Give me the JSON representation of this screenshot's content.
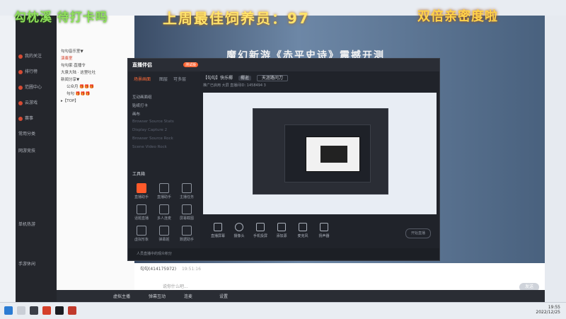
{
  "overlay": {
    "left_caption": "勾枕溪 待打卡吗",
    "center_caption": "上周最佳饲养员：97",
    "right_caption": "双倍亲密度啦"
  },
  "stream": {
    "title": "魔幻新游《赤平史诗》震撼开测"
  },
  "sidebar": {
    "items": [
      {
        "label": "我的关注"
      },
      {
        "label": "排行榜"
      },
      {
        "label": "范圃中心"
      },
      {
        "label": "云游戏"
      },
      {
        "label": "赛事"
      },
      {
        "label": "常用分类"
      },
      {
        "label": "网游竞技"
      },
      {
        "label": "单机热游"
      },
      {
        "label": "手游休闲"
      }
    ]
  },
  "room_tree": {
    "items": [
      {
        "label": "勾勾音乐室▼"
      },
      {
        "label": "演奏室"
      },
      {
        "label": "勾勾家·直播令"
      },
      {
        "label": "大泉大陆 · 这里吐吐"
      },
      {
        "label": "新闻分享▼"
      },
      {
        "label": "公众月 🎁🎁🎁"
      },
      {
        "label": "勾勾 🎁🎁🎁"
      },
      {
        "label": "▸【TOP】"
      }
    ]
  },
  "inner_app": {
    "logo": "直播伴侣",
    "badge": "测试版",
    "tabs": [
      {
        "label": "场景画面"
      },
      {
        "label": "图层"
      },
      {
        "label": "可多层"
      }
    ],
    "layers": [
      {
        "label": "互动画面组"
      },
      {
        "label": "贴纸打卡"
      },
      {
        "label": "画布"
      },
      {
        "label": "Browser Source Stats"
      },
      {
        "label": "Display Capture 2"
      },
      {
        "label": "Browser Source Rock"
      },
      {
        "label": "Scene Video Rock"
      }
    ],
    "tool_title": "工具箱",
    "tools": [
      {
        "label": "直播助手"
      },
      {
        "label": "直播助手"
      },
      {
        "label": "主播任务"
      },
      {
        "label": "话题直播"
      },
      {
        "label": "多人连麦"
      },
      {
        "label": "屏幕截图"
      },
      {
        "label": "虚拟形象"
      },
      {
        "label": "弹幕姬"
      },
      {
        "label": "数据助手"
      }
    ],
    "room_title": "【勾勾】快乐椰",
    "room_tag": "椰逝",
    "room_mode": "天涯路问刀",
    "status_line": "推广已启用  大屏  直播间ID: 1458494  3",
    "toolbar": [
      {
        "label": "直播屏幕"
      },
      {
        "label": "摄像头"
      },
      {
        "label": "手机投屏"
      },
      {
        "label": "添加源"
      },
      {
        "label": "麦克风"
      },
      {
        "label": "扬声器"
      }
    ],
    "start_live": "开始直播",
    "footer": "人员直播中的观众积分"
  },
  "chat": {
    "message_user": "勾勾(414175972)",
    "message_time": "19:51:16",
    "input_placeholder": "说你什么吧...",
    "send_label": "发送"
  },
  "live_bar": {
    "items": [
      {
        "label": "虚拟主播"
      },
      {
        "label": "弹幕互动"
      },
      {
        "label": "连麦"
      },
      {
        "label": "设置"
      }
    ]
  },
  "clock": {
    "time": "19:55",
    "date": "2022/12/25"
  },
  "colors": {
    "accent": "#ff6a38",
    "caption_green": "#8ee05a",
    "caption_yellow": "#ffe36b"
  }
}
